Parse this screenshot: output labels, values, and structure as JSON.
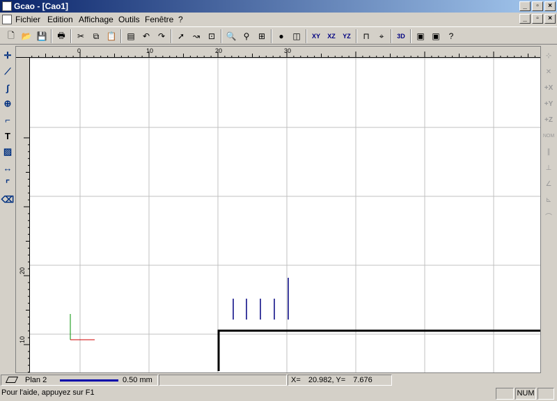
{
  "window": {
    "title": "Gcao - [Cao1]"
  },
  "menu": [
    "Fichier",
    "Edition",
    "Affichage",
    "Outils",
    "Fenêtre",
    "?"
  ],
  "toolbar": {
    "items": [
      "new-icon",
      "open-icon",
      "save-icon",
      "|",
      "print-icon",
      "|",
      "cut-icon",
      "copy-icon",
      "paste-icon",
      "|",
      "properties-icon",
      "undo-icon",
      "redo-icon",
      "|",
      "select-arrow-icon",
      "curve-select-icon",
      "zoom-window-icon",
      "|",
      "zoom-icon",
      "zoom-realtime-icon",
      "zoom-all-icon",
      "|",
      "render-sphere-icon",
      "cube-view-icon",
      "|",
      "plane-xy-icon",
      "plane-xz-icon",
      "plane-yz-icon",
      "|",
      "snap-magnet-icon",
      "snap-point-icon",
      "|",
      "view-3d-icon",
      "|",
      "frame-fab-icon",
      "frame-fab-3d-icon",
      "help-context-icon"
    ],
    "labels": {
      "plane-xy-icon": "XY",
      "plane-xz-icon": "XZ",
      "plane-yz-icon": "YZ",
      "view-3d-icon": "3D"
    }
  },
  "left_tools": [
    "points-icon",
    "polyline-icon",
    "curve-icon",
    "circle-icon",
    "rectangle-icon",
    "text-tool-icon",
    "hatch-icon",
    "dimension-icon",
    "fillet-icon",
    "eraser-icon"
  ],
  "text_tool_label": "T",
  "right_tools": [
    "point-snap-icon",
    "intersection-icon",
    "offset-x-icon",
    "offset-y-icon",
    "offset-z-icon",
    "nom-icon",
    "parallel-icon",
    "perpendicular-icon",
    "angle-icon",
    "orthogonal-icon",
    "tangent-icon"
  ],
  "right_tool_labels": {
    "offset-x-icon": "+X",
    "offset-y-icon": "+Y",
    "offset-z-icon": "+Z",
    "nom-icon": "NOM"
  },
  "ruler": {
    "top_labels": [
      {
        "value": "0",
        "pos": 0
      },
      {
        "value": "10",
        "pos": 10
      },
      {
        "value": "20",
        "pos": 20
      },
      {
        "value": "30",
        "pos": 30
      }
    ],
    "left_labels": [
      {
        "value": "20",
        "pos": 20
      },
      {
        "value": "10",
        "pos": 10
      }
    ]
  },
  "status": {
    "plane": "Plan 2",
    "line_width": "0.50 mm",
    "line_color": "#0000aa",
    "coord_x_label": "X=",
    "coord_x": "20.982,",
    "coord_y_label": "Y=",
    "coord_y": "7.676",
    "help": "Pour l'aide, appuyez sur F1",
    "num": "NUM"
  }
}
